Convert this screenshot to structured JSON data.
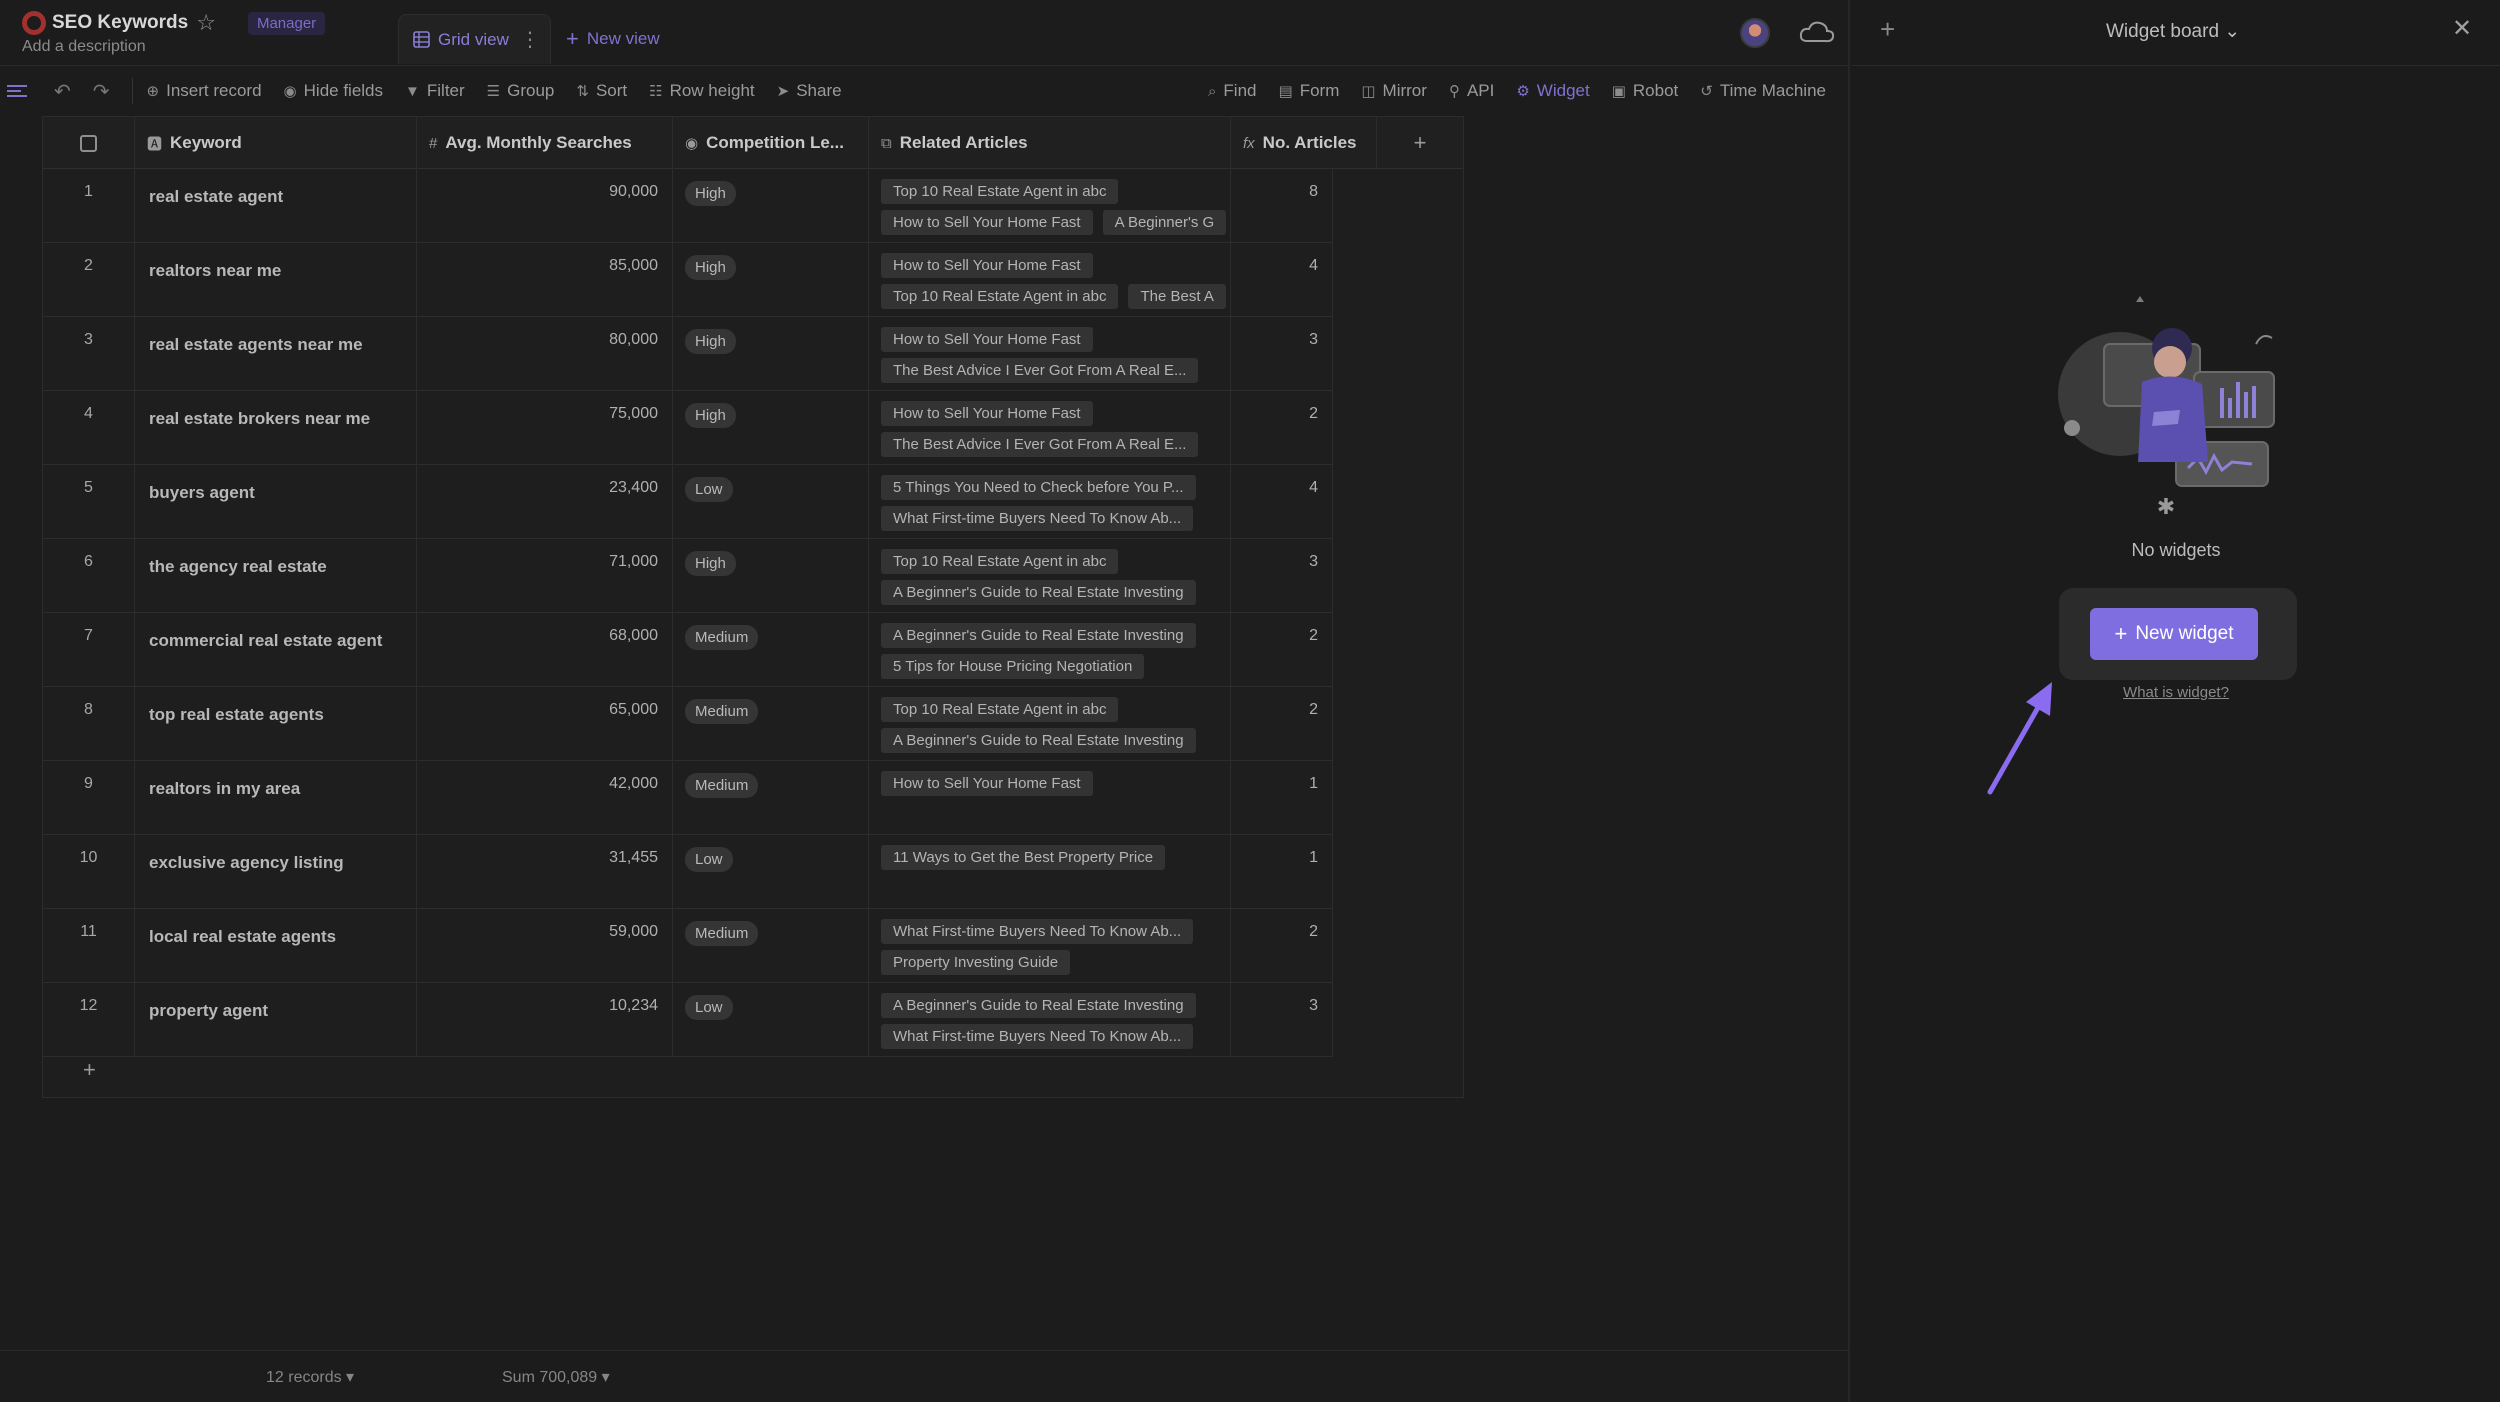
{
  "app": {
    "db_name": "SEO Keywords",
    "role_badge": "Manager",
    "description": "Add a description"
  },
  "views": {
    "active": "Grid view",
    "new_view": "New view"
  },
  "toolbar": {
    "insert_record": "Insert record",
    "hide_fields": "Hide fields",
    "filter": "Filter",
    "group": "Group",
    "sort": "Sort",
    "row_height": "Row height",
    "share": "Share",
    "find": "Find",
    "form": "Form",
    "mirror": "Mirror",
    "api": "API",
    "widget": "Widget",
    "robot": "Robot",
    "time_machine": "Time Machine"
  },
  "columns": {
    "keyword": "Keyword",
    "searches": "Avg. Monthly Searches",
    "competition": "Competition Le...",
    "articles": "Related Articles",
    "count": "No. Articles"
  },
  "rows": [
    {
      "n": "1",
      "keyword": "real estate agent",
      "searches": "90,000",
      "competition": "High",
      "articles": [
        "Top 10 Real Estate Agent in abc",
        "How to Sell Your Home Fast",
        "A Beginner's G"
      ],
      "count": "8"
    },
    {
      "n": "2",
      "keyword": "realtors near me",
      "searches": "85,000",
      "competition": "High",
      "articles": [
        "How to Sell Your Home Fast",
        "Top 10 Real Estate Agent in abc",
        "The Best A"
      ],
      "count": "4"
    },
    {
      "n": "3",
      "keyword": "real estate agents near me",
      "searches": "80,000",
      "competition": "High",
      "articles": [
        "How to Sell Your Home Fast",
        "The Best Advice I Ever Got From A Real E..."
      ],
      "count": "3"
    },
    {
      "n": "4",
      "keyword": "real estate brokers near me",
      "searches": "75,000",
      "competition": "High",
      "articles": [
        "How to Sell Your Home Fast",
        "The Best Advice I Ever Got From A Real E..."
      ],
      "count": "2"
    },
    {
      "n": "5",
      "keyword": "buyers agent",
      "searches": "23,400",
      "competition": "Low",
      "articles": [
        "5 Things You Need to Check before You P...",
        "What First-time Buyers Need To Know Ab..."
      ],
      "count": "4"
    },
    {
      "n": "6",
      "keyword": "the agency real estate",
      "searches": "71,000",
      "competition": "High",
      "articles": [
        "Top 10 Real Estate Agent in abc",
        "A Beginner's Guide to Real Estate Investing"
      ],
      "count": "3"
    },
    {
      "n": "7",
      "keyword": "commercial real estate agent",
      "searches": "68,000",
      "competition": "Medium",
      "articles": [
        "A Beginner's Guide to Real Estate Investing",
        "5 Tips for House Pricing Negotiation"
      ],
      "count": "2"
    },
    {
      "n": "8",
      "keyword": "top real estate agents",
      "searches": "65,000",
      "competition": "Medium",
      "articles": [
        "Top 10 Real Estate Agent in abc",
        "A Beginner's Guide to Real Estate Investing"
      ],
      "count": "2"
    },
    {
      "n": "9",
      "keyword": "realtors in my area",
      "searches": "42,000",
      "competition": "Medium",
      "articles": [
        "How to Sell Your Home Fast"
      ],
      "count": "1"
    },
    {
      "n": "10",
      "keyword": "exclusive agency listing",
      "searches": "31,455",
      "competition": "Low",
      "articles": [
        "11 Ways to Get the Best Property Price"
      ],
      "count": "1"
    },
    {
      "n": "11",
      "keyword": "local real estate agents",
      "searches": "59,000",
      "competition": "Medium",
      "articles": [
        "What First-time Buyers Need To Know Ab...",
        "Property Investing Guide"
      ],
      "count": "2"
    },
    {
      "n": "12",
      "keyword": "property agent",
      "searches": "10,234",
      "competition": "Low",
      "articles": [
        "A Beginner's Guide to Real Estate Investing",
        "What First-time Buyers Need To Know Ab..."
      ],
      "count": "3"
    }
  ],
  "footer": {
    "records": "12 records",
    "sum": "Sum 700,089"
  },
  "widget_panel": {
    "title": "Widget board",
    "empty_text": "No widgets",
    "new_widget": "New widget",
    "what_is": "What is widget?"
  },
  "colors": {
    "accent": "#7f6ee0",
    "accent_text": "#7f72cf",
    "background": "#1c1c1c"
  }
}
